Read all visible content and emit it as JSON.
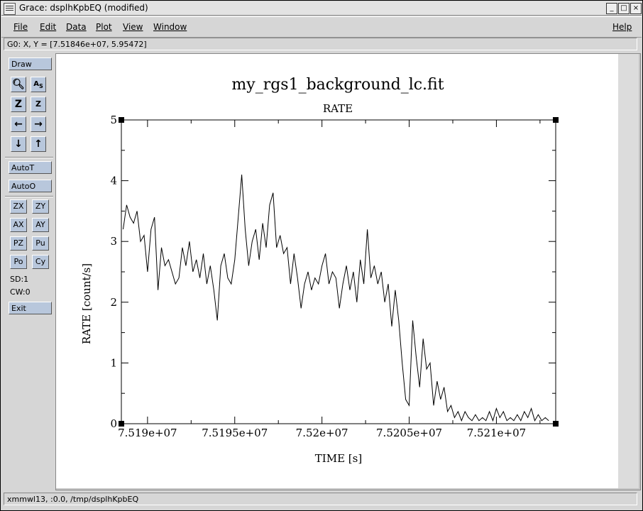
{
  "window": {
    "title": "Grace: dsplhKpbEQ (modified)",
    "buttons": [
      "minimize-icon",
      "maximize-icon",
      "close-icon"
    ]
  },
  "menubar": {
    "file": "File",
    "edit": "Edit",
    "data": "Data",
    "plot": "Plot",
    "view": "View",
    "window": "Window",
    "help": "Help"
  },
  "locator": "G0: X, Y = [7.51846e+07, 5.95472]",
  "tools": {
    "draw": "Draw",
    "icons": [
      "zoom-icon",
      "autoscale-icon",
      "zoom-z-icon",
      "zoom-z-small-icon",
      "left-arrow-icon",
      "right-arrow-icon",
      "down-arrow-icon",
      "up-arrow-icon"
    ],
    "autot": "AutoT",
    "autoo": "AutoO",
    "zx": "ZX",
    "zy": "ZY",
    "ax": "AX",
    "ay": "AY",
    "pz": "PZ",
    "pu": "Pu",
    "po": "Po",
    "cy": "Cy",
    "sd": "SD:1",
    "cw": "CW:0",
    "exit": "Exit"
  },
  "status": "xmmwl13, :0.0, /tmp/dsplhKpbEQ",
  "chart_data": {
    "type": "line",
    "title": "my_rgs1_background_lc.fit",
    "subtitle": "RATE",
    "xlabel": "TIME [s]",
    "ylabel": "RATE [count/s]",
    "xlim": [
      75188500,
      75213400
    ],
    "ylim": [
      0,
      5
    ],
    "xticks": [
      75190000,
      75195000,
      75200000,
      75205000,
      75210000
    ],
    "xtick_labels": [
      "7.519e+07",
      "7.5195e+07",
      "7.52e+07",
      "7.5205e+07",
      "7.521e+07"
    ],
    "yticks": [
      0,
      1,
      2,
      3,
      4,
      5
    ],
    "ytick_labels": [
      "0",
      "1",
      "2",
      "3",
      "4",
      "5"
    ],
    "grid": false,
    "series": [
      {
        "x": [
          75188600,
          75188800,
          75189000,
          75189200,
          75189400,
          75189600,
          75189800,
          75190000,
          75190200,
          75190400,
          75190600,
          75190800,
          75191000,
          75191200,
          75191400,
          75191600,
          75191800,
          75192000,
          75192200,
          75192400,
          75192600,
          75192800,
          75193000,
          75193200,
          75193400,
          75193600,
          75193800,
          75194000,
          75194200,
          75194400,
          75194600,
          75194800,
          75195000,
          75195200,
          75195400,
          75195600,
          75195800,
          75196000,
          75196200,
          75196400,
          75196600,
          75196800,
          75197000,
          75197200,
          75197400,
          75197600,
          75197800,
          75198000,
          75198200,
          75198400,
          75198600,
          75198800,
          75199000,
          75199200,
          75199400,
          75199600,
          75199800,
          75200000,
          75200200,
          75200400,
          75200600,
          75200800,
          75201000,
          75201200,
          75201400,
          75201600,
          75201800,
          75202000,
          75202200,
          75202400,
          75202600,
          75202800,
          75203000,
          75203200,
          75203400,
          75203600,
          75203800,
          75204000,
          75204200,
          75204400,
          75204600,
          75204800,
          75205000,
          75205200,
          75205400,
          75205600,
          75205800,
          75206000,
          75206200,
          75206400,
          75206600,
          75206800,
          75207000,
          75207200,
          75207400,
          75207600,
          75207800,
          75208000,
          75208200,
          75208400,
          75208600,
          75208800,
          75209000,
          75209200,
          75209400,
          75209600,
          75209800,
          75210000,
          75210200,
          75210400,
          75210600,
          75210800,
          75211000,
          75211200,
          75211400,
          75211600,
          75211800,
          75212000,
          75212200,
          75212400,
          75212600,
          75212800,
          75213000
        ],
        "y": [
          3.2,
          3.6,
          3.4,
          3.3,
          3.5,
          3.0,
          3.1,
          2.5,
          3.2,
          3.4,
          2.2,
          2.9,
          2.6,
          2.7,
          2.5,
          2.3,
          2.4,
          2.9,
          2.6,
          3.0,
          2.5,
          2.7,
          2.4,
          2.8,
          2.3,
          2.6,
          2.2,
          1.7,
          2.6,
          2.8,
          2.4,
          2.3,
          2.7,
          3.4,
          4.1,
          3.2,
          2.6,
          3.0,
          3.2,
          2.7,
          3.3,
          2.9,
          3.6,
          3.8,
          2.9,
          3.1,
          2.8,
          2.9,
          2.3,
          2.8,
          2.4,
          1.9,
          2.3,
          2.5,
          2.2,
          2.4,
          2.3,
          2.6,
          2.8,
          2.3,
          2.5,
          2.4,
          1.9,
          2.3,
          2.6,
          2.2,
          2.5,
          2.0,
          2.7,
          2.3,
          3.2,
          2.4,
          2.6,
          2.3,
          2.5,
          2.0,
          2.3,
          1.6,
          2.2,
          1.7,
          1.0,
          0.4,
          0.3,
          1.7,
          1.1,
          0.6,
          1.4,
          0.9,
          1.0,
          0.3,
          0.7,
          0.4,
          0.6,
          0.2,
          0.3,
          0.1,
          0.2,
          0.05,
          0.2,
          0.1,
          0.05,
          0.15,
          0.05,
          0.1,
          0.05,
          0.2,
          0.05,
          0.25,
          0.1,
          0.2,
          0.05,
          0.1,
          0.05,
          0.15,
          0.05,
          0.2,
          0.1,
          0.25,
          0.05,
          0.15,
          0.05,
          0.1,
          0.05
        ]
      }
    ]
  }
}
